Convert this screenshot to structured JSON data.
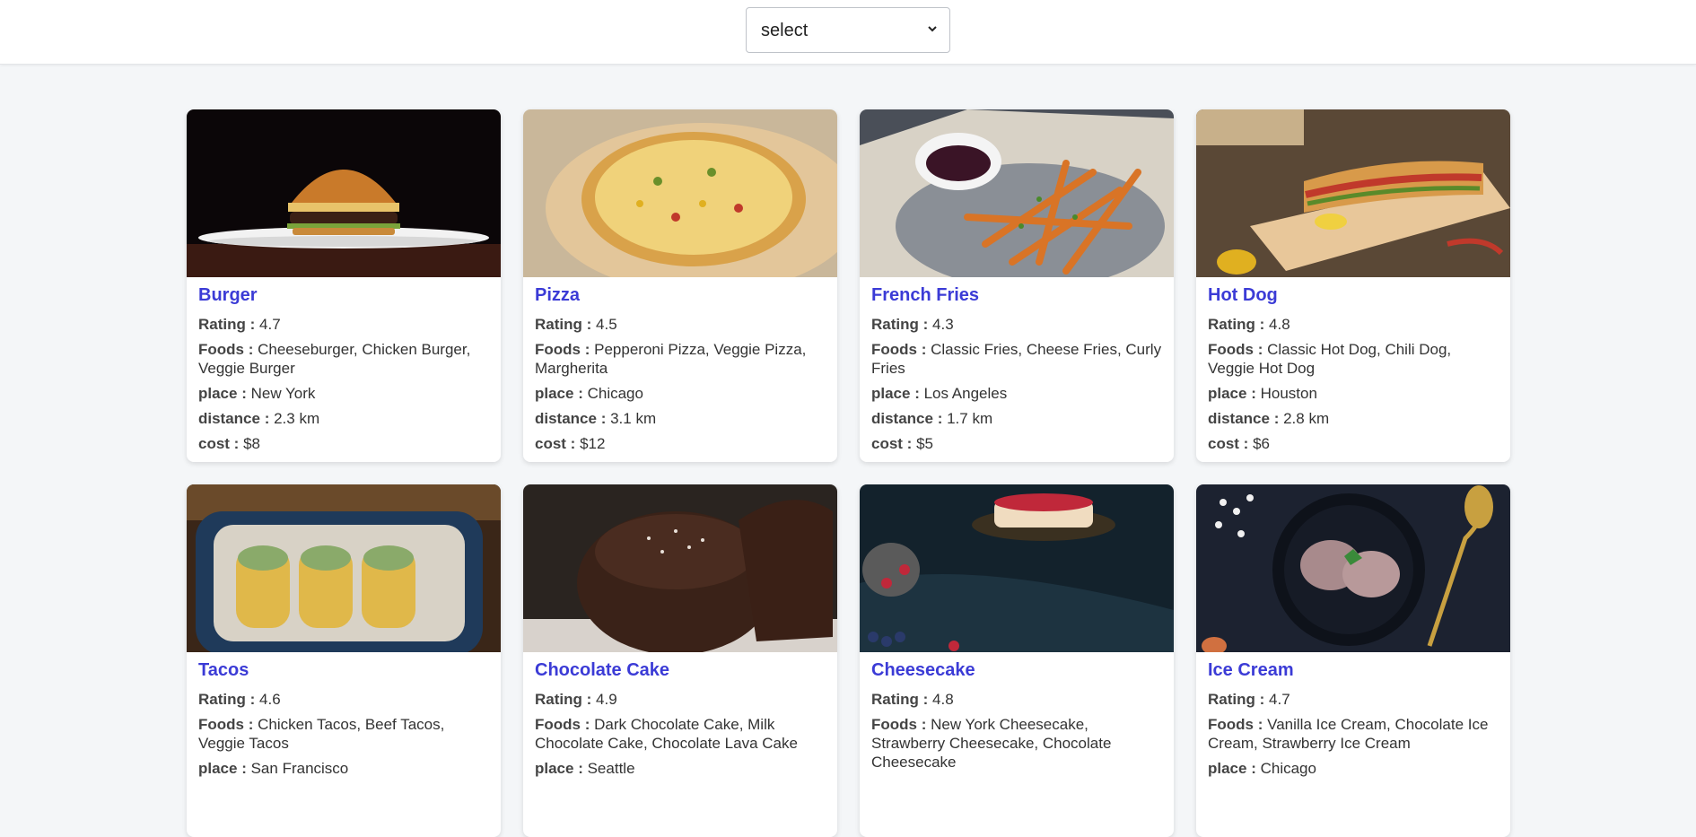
{
  "header": {
    "select_value": "select",
    "select_options": [
      "select"
    ]
  },
  "labels": {
    "rating": "Rating :",
    "foods": "Foods :",
    "place": "place :",
    "distance": "distance :",
    "cost": "cost :"
  },
  "cards": [
    {
      "title": "Burger",
      "rating": "4.7",
      "foods": "Cheeseburger, Chicken Burger, Veggie Burger",
      "place": "New York",
      "distance": "2.3 km",
      "cost": "$8",
      "image": "burger-photo"
    },
    {
      "title": "Pizza",
      "rating": "4.5",
      "foods": "Pepperoni Pizza, Veggie Pizza, Margherita",
      "place": "Chicago",
      "distance": "3.1 km",
      "cost": "$12",
      "image": "pizza-photo"
    },
    {
      "title": "French Fries",
      "rating": "4.3",
      "foods": "Classic Fries, Cheese Fries, Curly Fries",
      "place": "Los Angeles",
      "distance": "1.7 km",
      "cost": "$5",
      "image": "fries-photo"
    },
    {
      "title": "Hot Dog",
      "rating": "4.8",
      "foods": "Classic Hot Dog, Chili Dog, Veggie Hot Dog",
      "place": "Houston",
      "distance": "2.8 km",
      "cost": "$6",
      "image": "hotdog-photo"
    },
    {
      "title": "Tacos",
      "rating": "4.6",
      "foods": "Chicken Tacos, Beef Tacos, Veggie Tacos",
      "place": "San Francisco",
      "distance": "",
      "cost": "",
      "image": "tacos-photo"
    },
    {
      "title": "Chocolate Cake",
      "rating": "4.9",
      "foods": "Dark Chocolate Cake, Milk Chocolate Cake, Chocolate Lava Cake",
      "place": "Seattle",
      "distance": "",
      "cost": "",
      "image": "chocolate-cake-photo"
    },
    {
      "title": "Cheesecake",
      "rating": "4.8",
      "foods": "New York Cheesecake, Strawberry Cheesecake, Chocolate Cheesecake",
      "place": "",
      "distance": "",
      "cost": "",
      "image": "cheesecake-photo"
    },
    {
      "title": "Ice Cream",
      "rating": "4.7",
      "foods": "Vanilla Ice Cream, Chocolate Ice Cream, Strawberry Ice Cream",
      "place": "Chicago",
      "distance": "",
      "cost": "",
      "image": "ice-cream-photo"
    }
  ],
  "colors": {
    "title": "#3b3bd6",
    "background": "#f4f6f8"
  }
}
